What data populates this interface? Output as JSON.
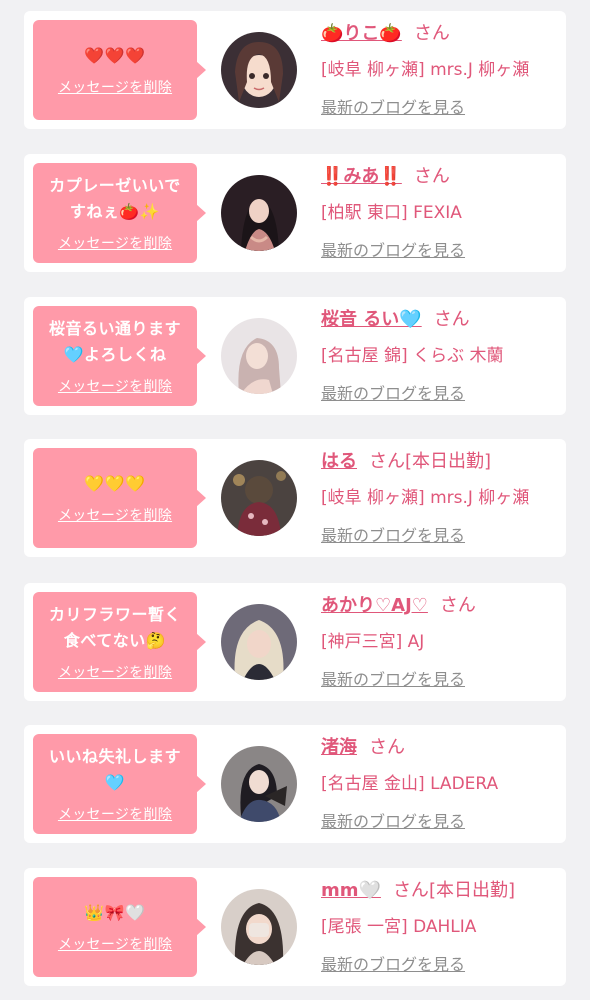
{
  "delete_label": "メッセージを削除",
  "san_label": "さん",
  "blog_label": "最新のブログを見る",
  "colors": {
    "page_bg": "#f1f1f3",
    "bubble_bg": "#ff9aa9",
    "accent_pink": "#e0577a",
    "link_gray": "#8e8e8e"
  },
  "cards": [
    {
      "message": "❤️❤️❤️",
      "name": "🍅りこ🍅",
      "tag": "",
      "shop": "[岐阜 柳ヶ瀬] mrs.J 柳ヶ瀬"
    },
    {
      "message": "カプレーゼいいで\nすねぇ🍅✨",
      "name": "‼️みあ‼️",
      "tag": "",
      "shop": "[柏駅 東口] FEXIA"
    },
    {
      "message": "桜音るい通ります\n🩵よろしくね",
      "name": "桜音 るい🩵",
      "tag": "",
      "shop": "[名古屋 錦] くらぶ 木蘭"
    },
    {
      "message": "💛💛💛",
      "name": "はる",
      "tag": "[本日出勤]",
      "shop": "[岐阜 柳ヶ瀬] mrs.J 柳ヶ瀬"
    },
    {
      "message": "カリフラワー暫く\n食べてない🤔",
      "name": "あかり♡AJ♡",
      "tag": "",
      "shop": "[神戸三宮] AJ"
    },
    {
      "message": "いいね失礼します\n🩵",
      "name": "渚海",
      "tag": "",
      "shop": "[名古屋 金山] LADERA"
    },
    {
      "message": "👑🎀🤍",
      "name": "mm🤍",
      "tag": "[本日出勤]",
      "shop": "[尾張 一宮] DAHLIA"
    }
  ]
}
